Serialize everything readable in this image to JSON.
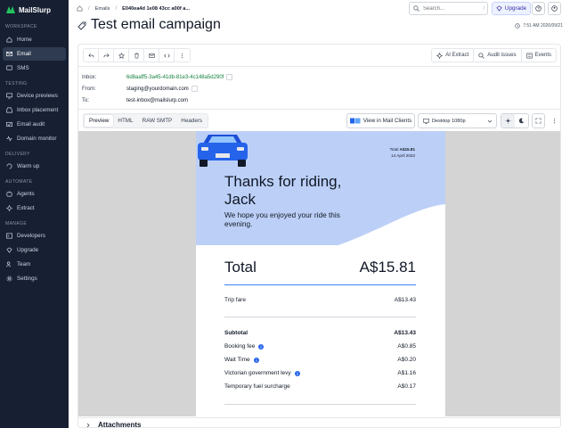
{
  "brand": {
    "name": "MailSlurp"
  },
  "sidebar": {
    "sections": [
      {
        "title": "WORKSPACE",
        "items": [
          {
            "label": "Home",
            "icon": "home-icon"
          },
          {
            "label": "Email",
            "icon": "mail-icon",
            "active": true
          },
          {
            "label": "SMS",
            "icon": "sms-icon"
          }
        ]
      },
      {
        "title": "TESTING",
        "items": [
          {
            "label": "Device previews",
            "icon": "device-icon"
          },
          {
            "label": "Inbox placement",
            "icon": "inbox-icon"
          },
          {
            "label": "Email audit",
            "icon": "audit-icon"
          },
          {
            "label": "Domain monitor",
            "icon": "monitor-icon"
          }
        ]
      },
      {
        "title": "DELIVERY",
        "items": [
          {
            "label": "Warm up",
            "icon": "warmup-icon"
          }
        ]
      },
      {
        "title": "AUTOMATE",
        "items": [
          {
            "label": "Agents",
            "icon": "agents-icon"
          },
          {
            "label": "Extract",
            "icon": "extract-icon"
          }
        ]
      },
      {
        "title": "MANAGE",
        "items": [
          {
            "label": "Developers",
            "icon": "code-icon"
          },
          {
            "label": "Upgrade",
            "icon": "upgrade-icon"
          },
          {
            "label": "Team",
            "icon": "team-icon"
          },
          {
            "label": "Settings",
            "icon": "gear-icon"
          }
        ]
      }
    ]
  },
  "topbar": {
    "breadcrumb_1": "Emails",
    "breadcrumb_2": "E040ea4d 1e08 43cc a00f a...",
    "search_placeholder": "Search...",
    "search_shortcut": "/",
    "upgrade_label": "Upgrade"
  },
  "page": {
    "title": "Test email campaign",
    "timestamp": "7:51 AM 2026/09/21"
  },
  "toolbar": {
    "ai_extract": "AI Extract",
    "audit_issues": "Audit issues",
    "events": "Events"
  },
  "meta": {
    "inbox_label": "Inbox:",
    "inbox_value": "6d8aaff5-3a45-41db-81e3-4c148a5d290f",
    "from_label": "From:",
    "from_value": "staging@yourdomain.com",
    "to_label": "To:",
    "to_value": "test-inbox@mailslurp.com"
  },
  "view": {
    "tabs": [
      "Preview",
      "HTML",
      "RAW SMTP",
      "Headers"
    ],
    "mail_clients_label": "View in Mail Clients",
    "device_label": "Desktop 1080p"
  },
  "email": {
    "top_total_label": "Total",
    "top_total_value": "A$15.81",
    "top_date": "14 April 2023",
    "headline": "Thanks for riding, Jack",
    "subline": "We hope you enjoyed your ride this evening.",
    "total_label": "Total",
    "total_value": "A$15.81",
    "trip_fare_label": "Trip fare",
    "trip_fare_value": "A$13.43",
    "subtotal_label": "Subtotal",
    "subtotal_value": "A$13.43",
    "booking_fee_label": "Booking fee",
    "booking_fee_value": "A$0.85",
    "wait_time_label": "Wait Time",
    "wait_time_value": "A$0.20",
    "levy_label": "Victorian government levy",
    "levy_value": "A$1.16",
    "fuel_label": "Temporary fuel surcharge",
    "fuel_value": "A$0.17"
  },
  "attachments": {
    "title": "Attachments"
  },
  "colors": {
    "sidebar_bg": "#172033",
    "hero_blue": "#bcd0f7",
    "car_blue": "#2563eb",
    "link_green": "#15803d"
  }
}
